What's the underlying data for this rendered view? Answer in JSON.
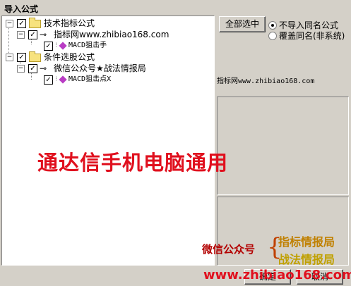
{
  "window": {
    "title": "导入公式"
  },
  "tree": {
    "group1": {
      "label": "技术指标公式",
      "child": {
        "label": "指标网www.zhibiao168.com",
        "leaf": {
          "label": "MACD狙击手"
        }
      }
    },
    "group2": {
      "label": "条件选股公式",
      "child": {
        "label": "微信公众号★战法情报局",
        "leaf": {
          "label": "MACD狙击点X"
        }
      }
    },
    "expand_glyph": "−",
    "check_glyph": "✓"
  },
  "buttons": {
    "select_all": "全部选中",
    "ok": "确定",
    "cancel": "取消"
  },
  "options": {
    "no_import_same": "不导入同名公式",
    "overwrite_same": "覆盖同名(非系统)",
    "selected": "no_import_same"
  },
  "detail": {
    "source": "指标网www.zhibiao168.com"
  },
  "watermark": {
    "main": "通达信手机电脑通用",
    "wechat": "微信公众号",
    "brace": "{",
    "name1": "指标情报局",
    "name2": "战法情报局",
    "url": "www.zhibiao168.com"
  }
}
